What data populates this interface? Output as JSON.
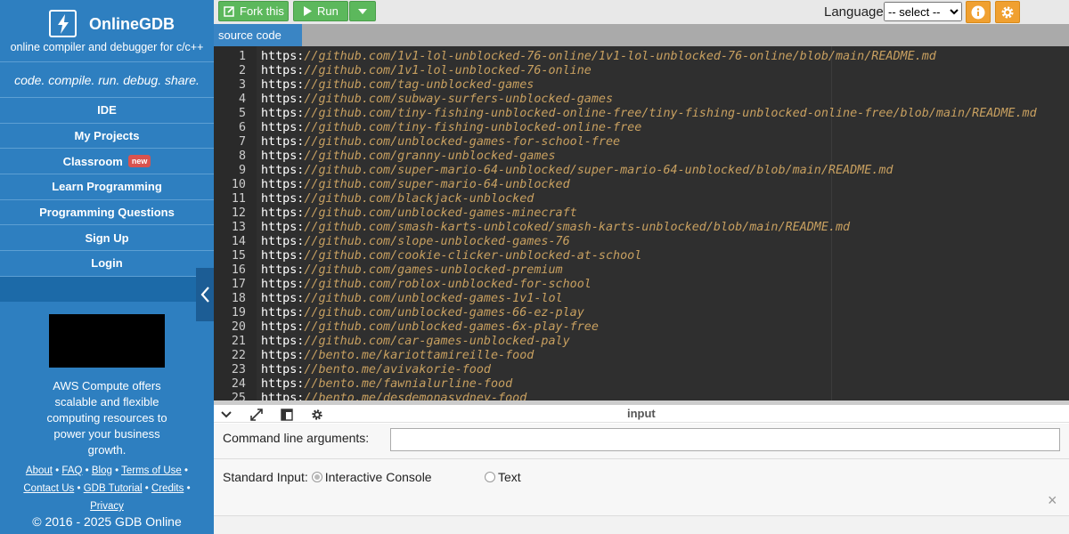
{
  "brand": {
    "name": "OnlineGDB",
    "tagline": "online compiler and debugger for c/c++"
  },
  "slogan": "code. compile. run. debug. share.",
  "nav": {
    "items": [
      {
        "label": "IDE"
      },
      {
        "label": "My Projects"
      },
      {
        "label": "Classroom",
        "badge": "new"
      },
      {
        "label": "Learn Programming"
      },
      {
        "label": "Programming Questions"
      },
      {
        "label": "Sign Up"
      },
      {
        "label": "Login"
      }
    ]
  },
  "ad": {
    "text": "AWS Compute offers scalable and flexible computing resources to power your business growth."
  },
  "footer": {
    "links": [
      "About",
      "FAQ",
      "Blog",
      "Terms of Use",
      "Contact Us",
      "GDB Tutorial",
      "Credits",
      "Privacy"
    ],
    "copyright": "© 2016 - 2025 GDB Online"
  },
  "toolbar": {
    "fork_label": "Fork this",
    "run_label": "Run",
    "language_label": "Language",
    "language_selected": "-- select --"
  },
  "tabs": {
    "source_label": "source code"
  },
  "editor": {
    "lines": [
      {
        "num": "1",
        "proto": "https:",
        "rest": "//github.com/1v1-lol-unblocked-76-online/1v1-lol-unblocked-76-online/blob/main/README.md"
      },
      {
        "num": "2",
        "proto": "https:",
        "rest": "//github.com/1v1-lol-unblocked-76-online"
      },
      {
        "num": "3",
        "proto": "https:",
        "rest": "//github.com/tag-unblocked-games"
      },
      {
        "num": "4",
        "proto": "https:",
        "rest": "//github.com/subway-surfers-unblocked-games"
      },
      {
        "num": "5",
        "proto": "https:",
        "rest": "//github.com/tiny-fishing-unblocked-online-free/tiny-fishing-unblocked-online-free/blob/main/README.md"
      },
      {
        "num": "6",
        "proto": "https:",
        "rest": "//github.com/tiny-fishing-unblocked-online-free"
      },
      {
        "num": "7",
        "proto": "https:",
        "rest": "//github.com/unblocked-games-for-school-free"
      },
      {
        "num": "8",
        "proto": "https:",
        "rest": "//github.com/granny-unblocked-games"
      },
      {
        "num": "9",
        "proto": "https:",
        "rest": "//github.com/super-mario-64-unblocked/super-mario-64-unblocked/blob/main/README.md"
      },
      {
        "num": "10",
        "proto": "https:",
        "rest": "//github.com/super-mario-64-unblocked"
      },
      {
        "num": "11",
        "proto": "https:",
        "rest": "//github.com/blackjack-unblocked"
      },
      {
        "num": "12",
        "proto": "https:",
        "rest": "//github.com/unblocked-games-minecraft"
      },
      {
        "num": "13",
        "proto": "https:",
        "rest": "//github.com/smash-karts-unblcoked/smash-karts-unblocked/blob/main/README.md"
      },
      {
        "num": "14",
        "proto": "https:",
        "rest": "//github.com/slope-unblocked-games-76"
      },
      {
        "num": "15",
        "proto": "https:",
        "rest": "//github.com/cookie-clicker-unblocked-at-school"
      },
      {
        "num": "16",
        "proto": "https:",
        "rest": "//github.com/games-unblocked-premium"
      },
      {
        "num": "17",
        "proto": "https:",
        "rest": "//github.com/roblox-unblocked-for-school"
      },
      {
        "num": "18",
        "proto": "https:",
        "rest": "//github.com/unblocked-games-1v1-lol"
      },
      {
        "num": "19",
        "proto": "https:",
        "rest": "//github.com/unblocked-games-66-ez-play"
      },
      {
        "num": "20",
        "proto": "https:",
        "rest": "//github.com/unblocked-games-6x-play-free"
      },
      {
        "num": "21",
        "proto": "https:",
        "rest": "//github.com/car-games-unblocked-paly"
      },
      {
        "num": "22",
        "proto": "https:",
        "rest": "//bento.me/kariottamireille-food"
      },
      {
        "num": "23",
        "proto": "https:",
        "rest": "//bento.me/avivakorie-food"
      },
      {
        "num": "24",
        "proto": "https:",
        "rest": "//bento.me/fawnialurline-food"
      },
      {
        "num": "25",
        "proto": "https:",
        "rest": "//bento.me/desdemonasydney-food"
      }
    ]
  },
  "io": {
    "title": "input",
    "cla_label": "Command line arguments:",
    "cla_value": "",
    "std_label": "Standard Input:",
    "interactive_label": "Interactive Console",
    "text_label": "Text",
    "close_glyph": "×"
  },
  "colors": {
    "sidebar": "#2e7fc0",
    "run_green": "#5cb85c",
    "orange": "#f0a030",
    "editor_bg": "#2f2f2f",
    "code_string": "#c8a060"
  }
}
